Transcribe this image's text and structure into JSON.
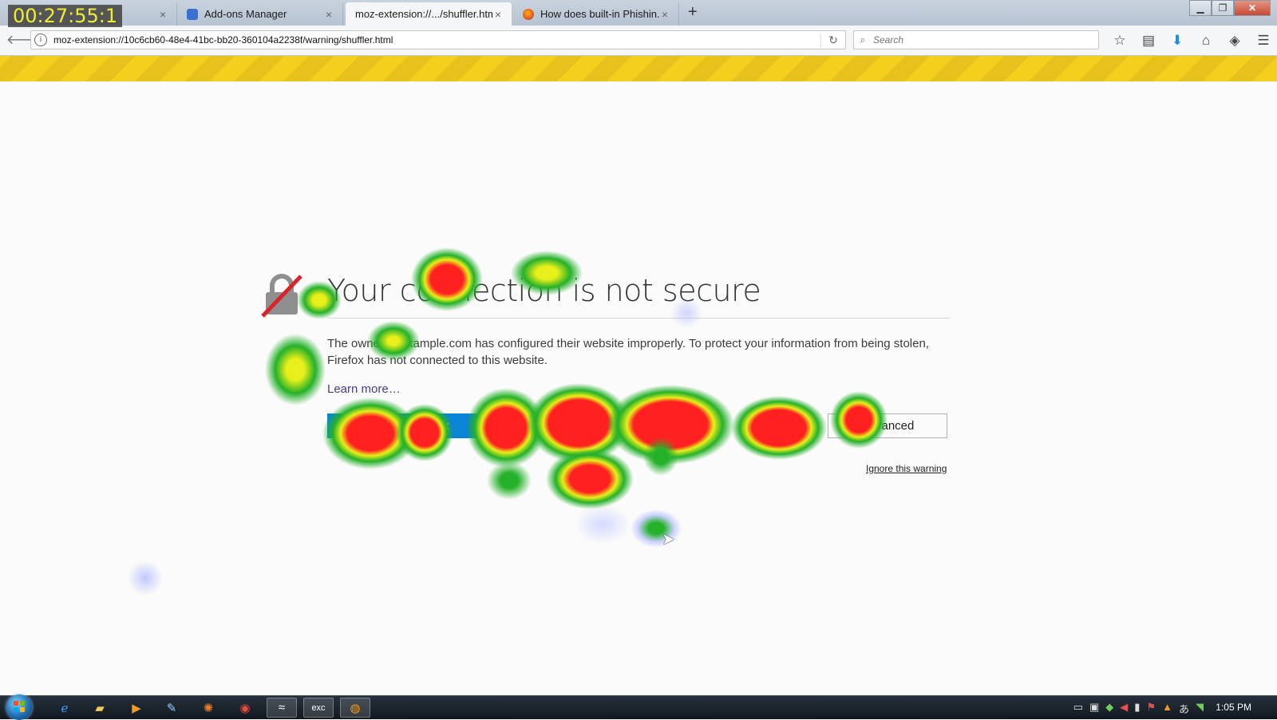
{
  "timer": "00:27:55:1",
  "tabs": [
    {
      "label": "Add-ons Manager",
      "close": "×"
    },
    {
      "label": "moz-extension://.../shuffler.html",
      "close": "×"
    },
    {
      "label": "How does built-in Phishin...",
      "close": "×"
    }
  ],
  "newtab_label": "+",
  "navbar": {
    "url": "moz-extension://10c6cb60-48e4-41bc-bb20-360104a2238f/warning/shuffler.html",
    "search_placeholder": "Search"
  },
  "error_page": {
    "title": "Your connection is not secure",
    "description": "The owner of example.com has configured their website improperly. To protect your information from being stolen, Firefox has not connected to this website.",
    "learn_more": "Learn more…",
    "go_back": "Go Back",
    "advanced": "Advanced",
    "ignore": "Ignore this warning"
  },
  "taskbar": {
    "clock": "1:05 PM",
    "apps": [
      "internet-explorer",
      "file-explorer",
      "media-player",
      "paint",
      "pinwheel",
      "chrome",
      "task-app",
      "exc-app",
      "firefox"
    ]
  },
  "colors": {
    "stripe": "#f4cf1e",
    "primary_button": "#0a84d6",
    "heat_hot": "#ff2020",
    "heat_warm": "#e8ef1a",
    "heat_cool": "#25b12a",
    "heat_cold": "#9aa7ff"
  }
}
